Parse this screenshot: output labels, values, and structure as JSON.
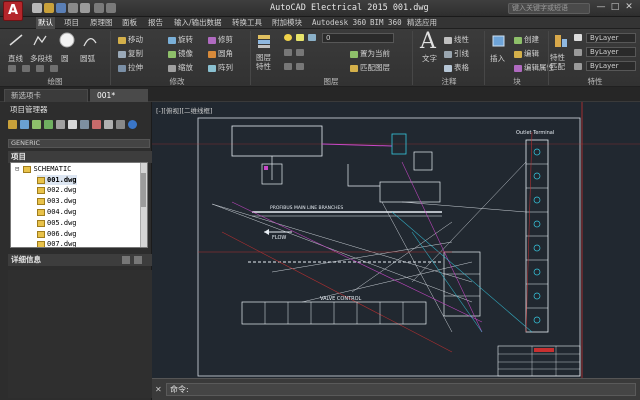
{
  "title_bar": {
    "logo_letter": "A",
    "window_title": "AutoCAD Electrical 2015    001.dwg",
    "search_placeholder": "键入关键字或短语",
    "min": "—",
    "max": "□",
    "close": "✕"
  },
  "menu": [
    "默认",
    "项目",
    "原理图",
    "面板",
    "报告",
    "输入/输出数据",
    "转换工具",
    "附加模块",
    "Autodesk 360",
    "BIM 360",
    "精选应用"
  ],
  "ribbon": {
    "draw": {
      "line": "直线",
      "polyline": "多段线",
      "circle": "圆",
      "arc": "圆弧",
      "label": "绘图"
    },
    "modify": {
      "move": "移动",
      "rotate": "旋转",
      "trim": "修剪",
      "copy": "复制",
      "mirror": "镜像",
      "fillet": "圆角",
      "stretch": "拉伸",
      "scale": "缩放",
      "array": "阵列",
      "label": "修改"
    },
    "layers": {
      "layer_props": "图层\n特性",
      "current": "0",
      "make_current": "置为当前",
      "match": "匹配图层",
      "label": "图层"
    },
    "annotation": {
      "text": "文字",
      "linear": "线性",
      "leader": "引线",
      "table": "表格",
      "label": "注释"
    },
    "block": {
      "insert": "插入",
      "create": "创建",
      "edit": "编辑",
      "edit_attr": "编辑属性",
      "label": "块"
    },
    "properties": {
      "match": "特性\n匹配",
      "color": "ByLayer",
      "linetype": "ByLayer",
      "lineweight": "ByLayer",
      "label": "特性"
    }
  },
  "doc_tabs": [
    "新选项卡",
    "001*"
  ],
  "project_manager": {
    "header": "项目管理器",
    "dropdown": "GENERIC",
    "section_project": "项目",
    "root": "SCHEMATIC",
    "files": [
      "001.dwg",
      "002.dwg",
      "003.dwg",
      "004.dwg",
      "005.dwg",
      "006.dwg",
      "007.dwg"
    ],
    "section_details": "详细信息"
  },
  "drawing": {
    "view_label": "[-][俯视][二维线框]",
    "labels": {
      "outlet": "Outlet Terminal",
      "flow": "FLOW",
      "valve": "VALVE CONTROL",
      "pipe": "PROFIBUS MAIN LINE BRANCHES"
    }
  },
  "command": {
    "prompt": "命令:",
    "close": "✕"
  },
  "colors": {
    "accent_red": "#b4262b",
    "canvas": "#212830",
    "drawing_lines": "#e8eef4",
    "cyan": "#36c8e0",
    "magenta": "#c848c8",
    "red": "#c83030"
  }
}
